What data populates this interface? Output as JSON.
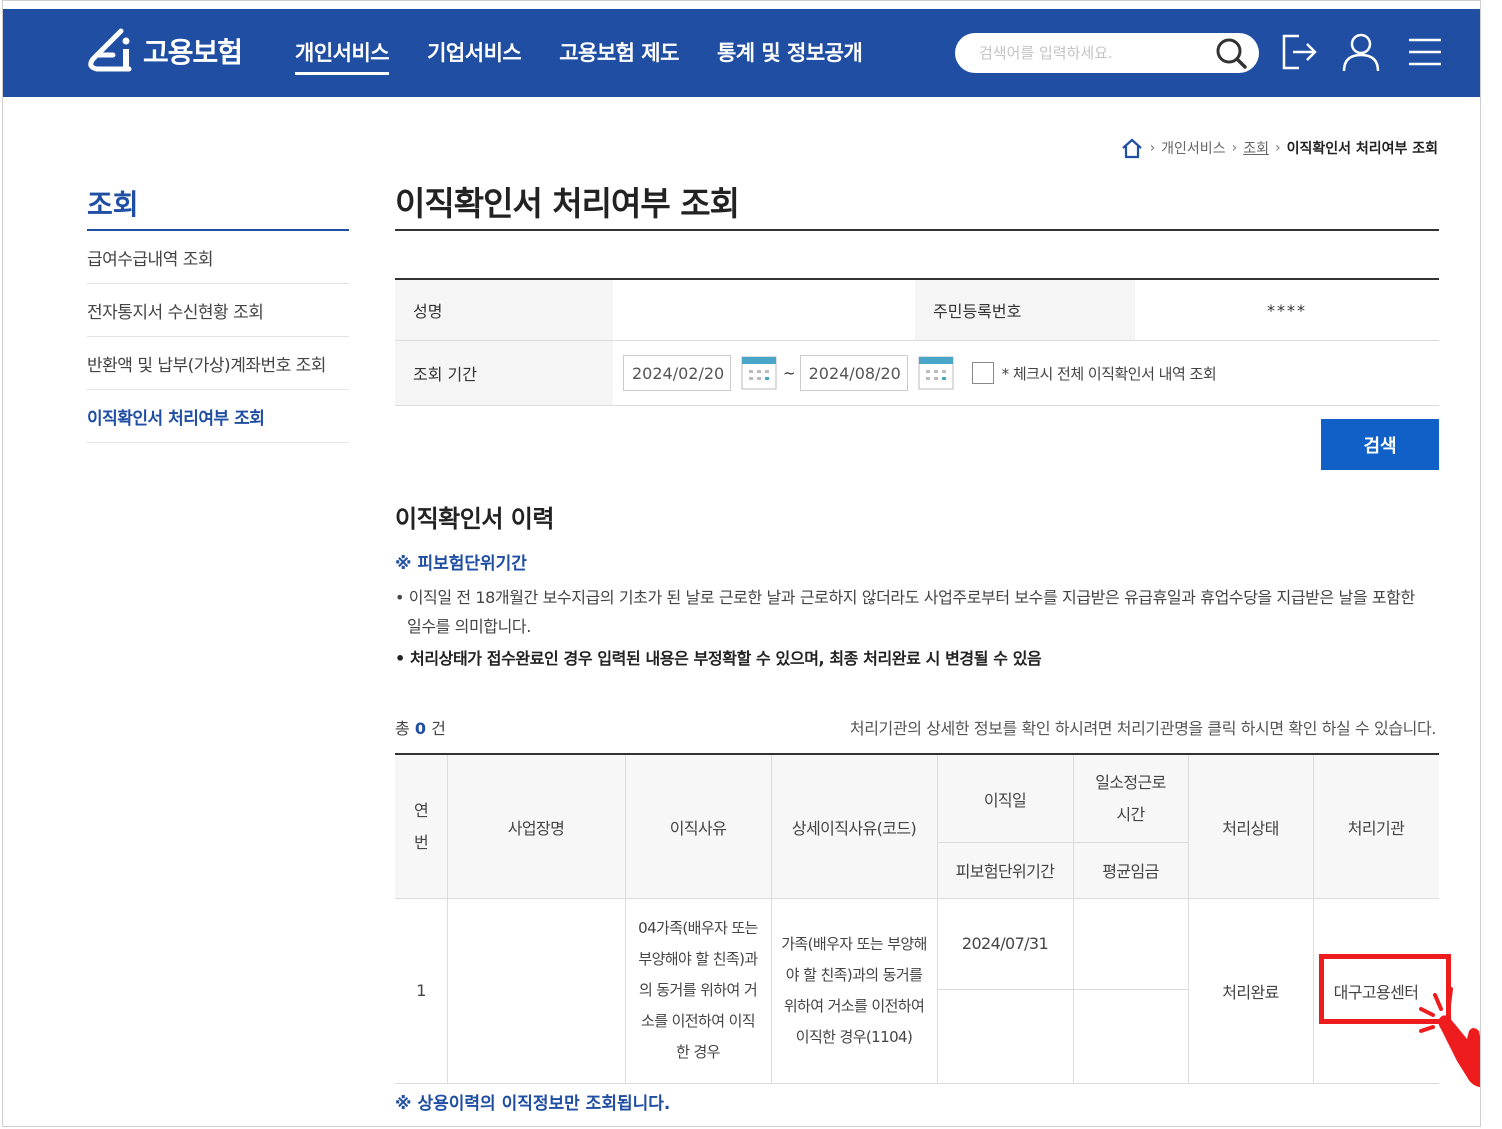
{
  "header": {
    "logo_text": "고용보험",
    "nav": [
      "개인서비스",
      "기업서비스",
      "고용보험 제도",
      "통계 및 정보공개"
    ],
    "search_placeholder": "검색어를 입력하세요."
  },
  "breadcrumb": {
    "items": [
      "개인서비스",
      "조회"
    ],
    "current": "이직확인서 처리여부 조회"
  },
  "lnb": {
    "title": "조회",
    "items": [
      "급여수급내역 조회",
      "전자통지서 수신현황 조회",
      "반환액 및 납부(가상)계좌번호 조회",
      "이직확인서 처리여부 조회"
    ]
  },
  "page": {
    "title": "이직확인서 처리여부 조회"
  },
  "form": {
    "name_label": "성명",
    "name_value": "",
    "rrn_label": "주민등록번호",
    "rrn_value": "****",
    "period_label": "조회 기간",
    "date_from": "2024/02/20",
    "tilde": "~",
    "date_to": "2024/08/20",
    "checkbox_label": "* 체크시 전체 이직확인서 내역 조회",
    "search_button": "검색"
  },
  "history": {
    "title": "이직확인서 이력",
    "note_title": "※ 피보험단위기간",
    "note1": "• 이직일 전 18개월간 보수지급의 기초가 된 날로 근로한 날과 근로하지 않더라도 사업주로부터 보수를 지급받은 유급휴일과 휴업수당을 지급받은 날을 포함한 일수를 의미합니다.",
    "note2": "• 처리상태가 접수완료인 경우 입력된 내용은 부정확할 수 있으며, 최종 처리완료 시 변경될 수 있음",
    "total_prefix": "총",
    "total_count": "0",
    "total_suffix": "건",
    "info": "처리기관의 상세한 정보를 확인 하시려면 처리기관명을 클릭 하시면 확인 하실 수 있습니다."
  },
  "table": {
    "headers": {
      "no": "연번",
      "company": "사업장명",
      "reason": "이직사유",
      "detail_reason": "상세이직사유(코드)",
      "leave_date": "이직일",
      "insured_period": "피보험단위기간",
      "hours": "일소정근로시간",
      "avg_wage": "평균임금",
      "status": "처리상태",
      "agency": "처리기관"
    },
    "rows": [
      {
        "no": "1",
        "company": "",
        "reason": "04가족(배우자 또는 부양해야 할 친족)과의 동거를 위하여 거소를 이전하여 이직한 경우",
        "detail_reason": "가족(배우자 또는 부양해야 할 친족)과의 동거를 위하여 거소를 이전하여 이직한 경우(1104)",
        "leave_date": "2024/07/31",
        "insured_period": "",
        "hours": "",
        "avg_wage": "",
        "status": "처리완료",
        "agency": "대구고용센터"
      }
    ]
  },
  "bottom_note": "※ 상용이력의 이직정보만 조회됩니다.",
  "colors": {
    "primary": "#1f4ea3",
    "button": "#1160c8",
    "highlight": "#ee1c1c"
  }
}
